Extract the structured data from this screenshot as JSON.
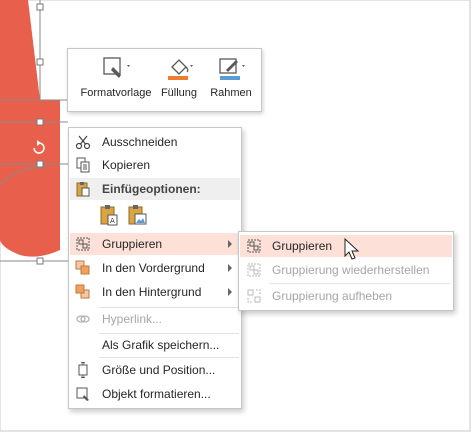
{
  "toolbar": {
    "style_label": "Formatvorlage",
    "fill_label": "Füllung",
    "outline_label": "Rahmen",
    "style_icon": "shape-style-icon",
    "fill_icon": "paint-bucket-icon",
    "outline_icon": "pen-outline-icon",
    "fill_color": "#ed7d31",
    "outline_color": "#5b9bd5"
  },
  "context_menu": {
    "items": [
      {
        "label": "Ausschneiden",
        "icon": "scissors-icon"
      },
      {
        "label": "Kopieren",
        "icon": "copy-icon"
      },
      {
        "label": "Einfügeoptionen:",
        "icon": "paste-icon"
      },
      {
        "label": "Gruppieren",
        "icon": "group-icon"
      },
      {
        "label": "In den Vordergrund",
        "icon": "bring-forward-icon"
      },
      {
        "label": "In den Hintergrund",
        "icon": "send-backward-icon"
      },
      {
        "label": "Hyperlink...",
        "icon": "link-icon"
      },
      {
        "label": "Als Grafik speichern...",
        "icon": ""
      },
      {
        "label": "Größe und Position...",
        "icon": "size-position-icon"
      },
      {
        "label": "Objekt formatieren...",
        "icon": "format-object-icon"
      }
    ],
    "paste_options": [
      {
        "name": "paste-keep-text-icon"
      },
      {
        "name": "paste-picture-icon"
      }
    ]
  },
  "submenu": {
    "items": [
      {
        "label": "Gruppieren",
        "icon": "group-icon",
        "enabled": true
      },
      {
        "label": "Gruppierung wiederherstellen",
        "icon": "regroup-icon",
        "enabled": false
      },
      {
        "label": "Gruppierung aufheben",
        "icon": "ungroup-icon",
        "enabled": false
      }
    ]
  },
  "colors": {
    "shape_fill": "#e8604c",
    "highlight": "#fde1d8"
  }
}
